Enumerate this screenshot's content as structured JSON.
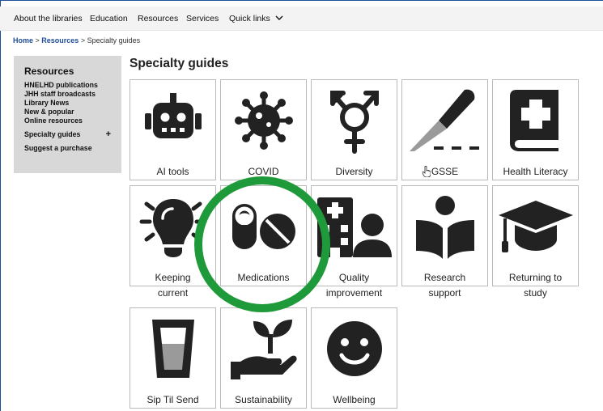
{
  "nav": {
    "items": [
      "About the libraries",
      "Education",
      "Resources",
      "Services",
      "Quick links"
    ]
  },
  "breadcrumb": {
    "home": "Home",
    "sep": " > ",
    "resources": "Resources",
    "current": "Specialty guides"
  },
  "sidebar": {
    "title": "Resources",
    "items": [
      "HNELHD publications",
      "JHH staff broadcasts",
      "Library News",
      "New & popular",
      "Online resources",
      "Specialty guides",
      "Suggest a purchase"
    ],
    "expand": "+"
  },
  "page_title": "Specialty guides",
  "tiles": [
    {
      "label": "AI tools",
      "icon": "robot-icon"
    },
    {
      "label": "COVID",
      "icon": "virus-icon"
    },
    {
      "label": "Diversity",
      "icon": "gender-symbol-icon"
    },
    {
      "label": "GSSE",
      "icon": "scalpel-icon"
    },
    {
      "label": "Health Literacy",
      "icon": "medical-book-icon"
    },
    {
      "label_1": "Keeping",
      "label_2": "current",
      "icon": "lightbulb-icon"
    },
    {
      "label": "Medications",
      "icon": "pills-icon"
    },
    {
      "label_1": "Quality",
      "label_2": "improvement",
      "icon": "hospital-user-icon"
    },
    {
      "label_1": "Research",
      "label_2": "support",
      "icon": "reading-person-icon"
    },
    {
      "label_1": "Returning to",
      "label_2": "study",
      "icon": "graduation-cap-icon"
    },
    {
      "label": "Sip Til Send",
      "icon": "glass-icon"
    },
    {
      "label": "Sustainability",
      "icon": "seedling-hand-icon"
    },
    {
      "label": "Wellbeing",
      "icon": "smiley-icon"
    }
  ],
  "colors": {
    "accent_link": "#1f4e9a",
    "highlight_ring": "#1f9a3a",
    "icon": "#222222",
    "sidebar_bg": "#d8d8d8"
  }
}
